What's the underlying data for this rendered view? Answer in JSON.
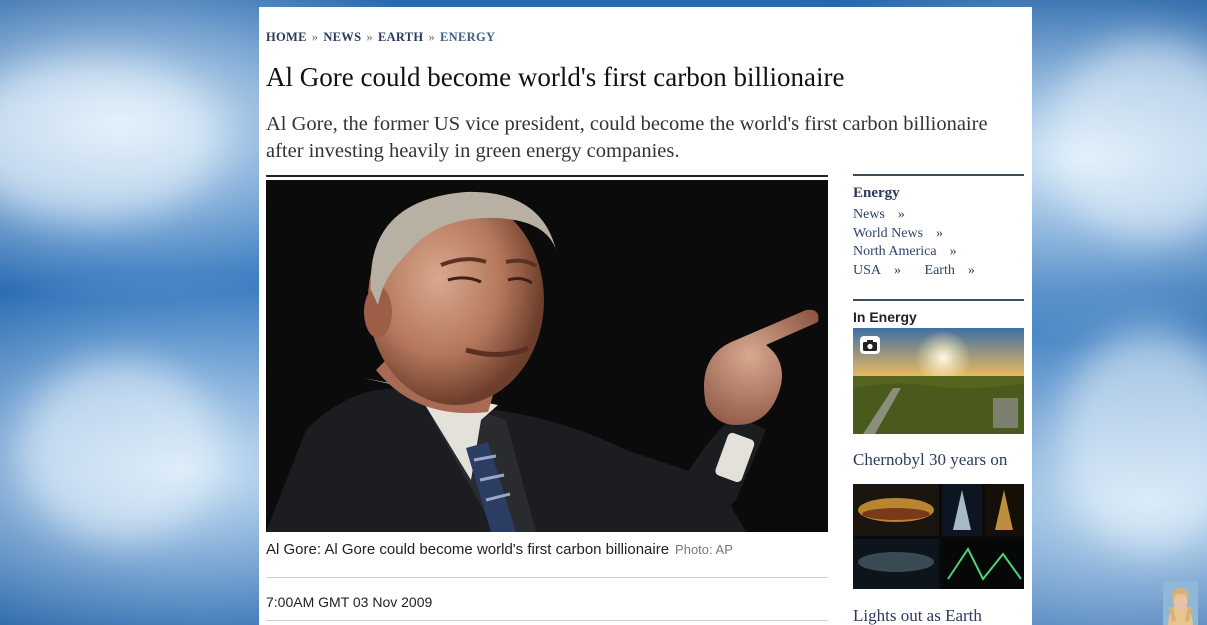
{
  "breadcrumb": {
    "items": [
      "HOME",
      "NEWS",
      "EARTH",
      "ENERGY"
    ],
    "separator": "»"
  },
  "article": {
    "headline": "Al Gore could become world's first carbon billionaire",
    "standfirst": "Al Gore, the former US vice president, could become the world's first carbon billionaire after investing heavily in green energy companies.",
    "caption": "Al Gore: Al Gore could become world's first carbon billionaire",
    "photo_credit": "Photo: AP",
    "dateline": "7:00AM GMT 03 Nov 2009"
  },
  "sidebar": {
    "title": "Energy",
    "links": [
      "News",
      "World News",
      "North America",
      "USA",
      "Earth"
    ],
    "link_arrow": "»",
    "section_heading": "In Energy",
    "stories": [
      {
        "title": "Chernobyl 30 years on",
        "icon": "camera-icon"
      },
      {
        "title": "Lights out as Earth"
      }
    ]
  },
  "colors": {
    "link": "#2b3b5c",
    "background": "#2a6fb8"
  }
}
